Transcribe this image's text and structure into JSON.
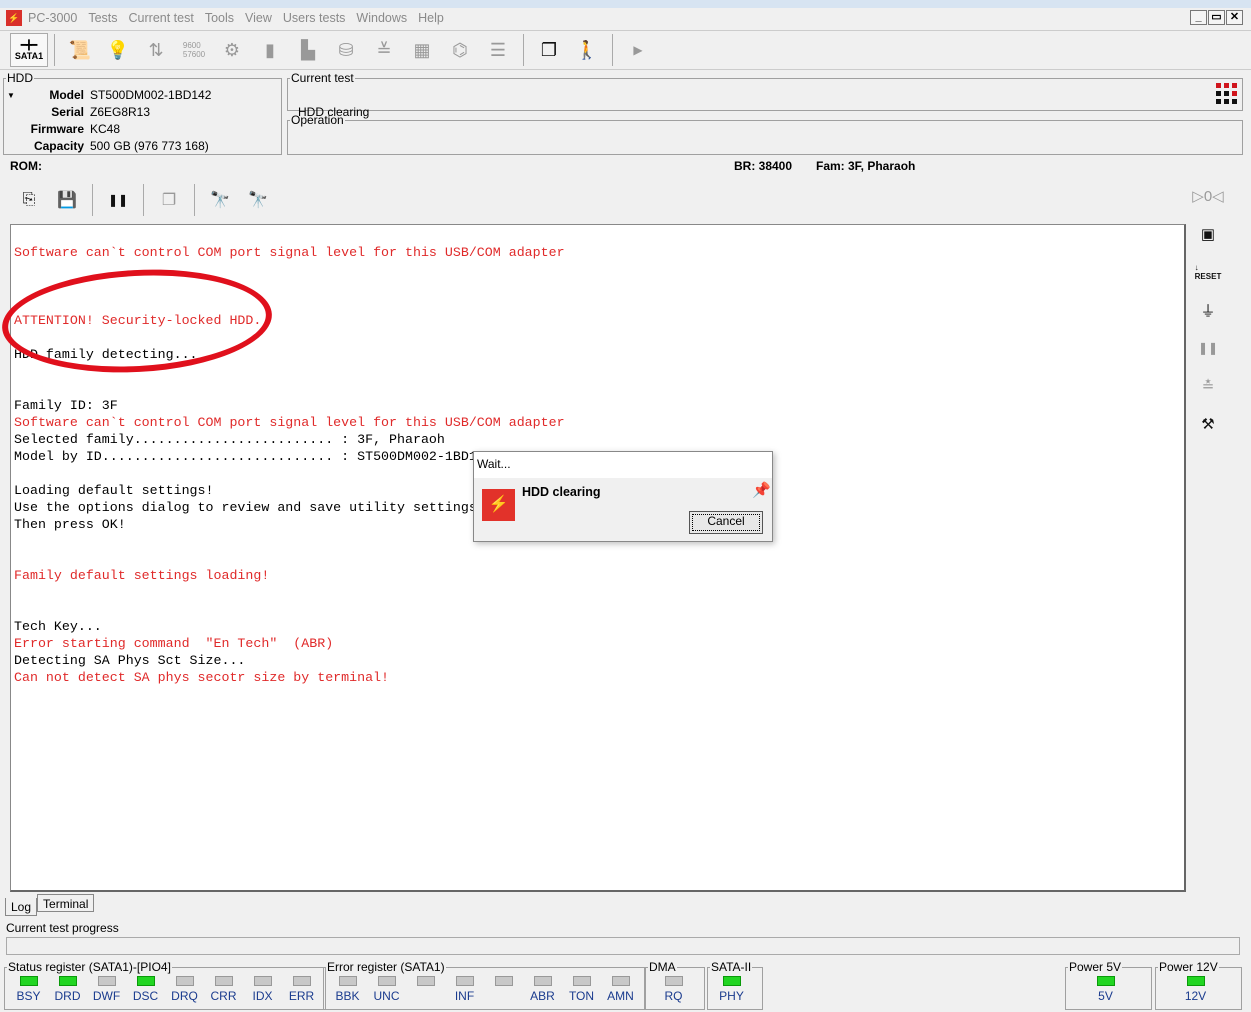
{
  "menu": {
    "app": "PC-3000",
    "items": [
      "Tests",
      "Current test",
      "Tools",
      "View",
      "Users tests",
      "Windows",
      "Help"
    ]
  },
  "window_buttons": [
    "_",
    "▭",
    "✕"
  ],
  "toolbar": {
    "sata_label": "SATA1"
  },
  "hdd": {
    "legend": "HDD",
    "fields": [
      {
        "k": "Model",
        "v": "ST500DM002-1BD142"
      },
      {
        "k": "Serial",
        "v": "Z6EG8R13"
      },
      {
        "k": "Firmware",
        "v": "KC48"
      },
      {
        "k": "Capacity",
        "v": "500 GB (976 773 168)"
      }
    ]
  },
  "current_test": {
    "legend": "Current test",
    "value": "HDD clearing"
  },
  "operation": {
    "legend": "Operation"
  },
  "infobar": {
    "rom": "ROM:",
    "br": "BR: 38400",
    "fam": "Fam: 3F, Pharaoh"
  },
  "log": [
    {
      "t": "Software can`t control COM port signal level for this USB/COM adapter",
      "red": true
    },
    {
      "t": ""
    },
    {
      "t": ""
    },
    {
      "t": ""
    },
    {
      "t": "ATTENTION! Security-locked HDD.",
      "red": true
    },
    {
      "t": ""
    },
    {
      "t": "HDD family detecting..."
    },
    {
      "t": ""
    },
    {
      "t": ""
    },
    {
      "t": "Family ID: 3F"
    },
    {
      "t": "Software can`t control COM port signal level for this USB/COM adapter",
      "red": true
    },
    {
      "t": "Selected family......................... : 3F, Pharaoh"
    },
    {
      "t": "Model by ID............................. : ST500DM002-1BD142"
    },
    {
      "t": ""
    },
    {
      "t": "Loading default settings!"
    },
    {
      "t": "Use the options dialog to review and save utility settings"
    },
    {
      "t": "Then press OK!"
    },
    {
      "t": ""
    },
    {
      "t": ""
    },
    {
      "t": "Family default settings loading!",
      "red": true
    },
    {
      "t": ""
    },
    {
      "t": ""
    },
    {
      "t": "Tech Key..."
    },
    {
      "t": "Error starting command  \"En Tech\"  (ABR)",
      "red": true
    },
    {
      "t": "Detecting SA Phys Sct Size..."
    },
    {
      "t": "Can not detect SA phys secotr size by terminal!",
      "red": true
    }
  ],
  "tabs": {
    "log": "Log",
    "terminal": "Terminal"
  },
  "progress": {
    "label": "Current test progress",
    "value": 0
  },
  "status_register": {
    "legend": "Status register (SATA1)-[PIO4]",
    "leds": [
      {
        "l": "BSY",
        "on": true
      },
      {
        "l": "DRD",
        "on": true
      },
      {
        "l": "DWF",
        "on": false
      },
      {
        "l": "DSC",
        "on": true
      },
      {
        "l": "DRQ",
        "on": false
      },
      {
        "l": "CRR",
        "on": false
      },
      {
        "l": "IDX",
        "on": false
      },
      {
        "l": "ERR",
        "on": false
      }
    ]
  },
  "error_register": {
    "legend": "Error register (SATA1)",
    "leds": [
      {
        "l": "BBK",
        "on": false
      },
      {
        "l": "UNC",
        "on": false
      },
      {
        "l": "",
        "on": false
      },
      {
        "l": "INF",
        "on": false
      },
      {
        "l": "",
        "on": false
      },
      {
        "l": "ABR",
        "on": false
      },
      {
        "l": "TON",
        "on": false
      },
      {
        "l": "AMN",
        "on": false
      }
    ]
  },
  "dma": {
    "legend": "DMA",
    "leds": [
      {
        "l": "RQ",
        "on": false
      }
    ]
  },
  "sata2": {
    "legend": "SATA-II",
    "leds": [
      {
        "l": "PHY",
        "on": true
      }
    ]
  },
  "power5": {
    "legend": "Power 5V",
    "leds": [
      {
        "l": "5V",
        "on": true
      }
    ]
  },
  "power12": {
    "legend": "Power 12V",
    "leds": [
      {
        "l": "12V",
        "on": true
      }
    ]
  },
  "dialog": {
    "title": "Wait...",
    "message": "HDD clearing",
    "cancel": "Cancel"
  }
}
